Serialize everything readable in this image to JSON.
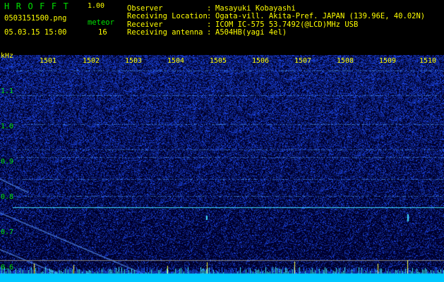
{
  "header": {
    "brand": "HROFFT",
    "version": "1.00",
    "filename": "0503151500.png",
    "datetime": "05.03.15 15:00",
    "meteor_label": "meteor",
    "meteor_count": "16"
  },
  "info": [
    {
      "label": "Observer",
      "value": "Masayuki Kobayashi"
    },
    {
      "label": "Receiving Location",
      "value": "Ogata-vill. Akita-Pref. JAPAN (139.96E, 40.02N)"
    },
    {
      "label": "Receiver",
      "value": "ICOM IC-575 53.7492(@LCD)MHz USB"
    },
    {
      "label": "Receiving antenna",
      "value": "A504HB(yagi 4el)"
    }
  ],
  "colon": ":",
  "spectrogram": {
    "y_unit": "kHz",
    "y_ticks": [
      "1.1",
      "1.0",
      "0.9",
      "0.8",
      "0.7",
      "0.6"
    ],
    "x_ticks": [
      "1501",
      "1502",
      "1503",
      "1504",
      "1505",
      "1506",
      "1507",
      "1508",
      "1509",
      "1510"
    ],
    "colors": {
      "background": "#000018",
      "noise": "#1a3cff",
      "signal": "#40e0ff",
      "spike": "#ffff40"
    }
  }
}
